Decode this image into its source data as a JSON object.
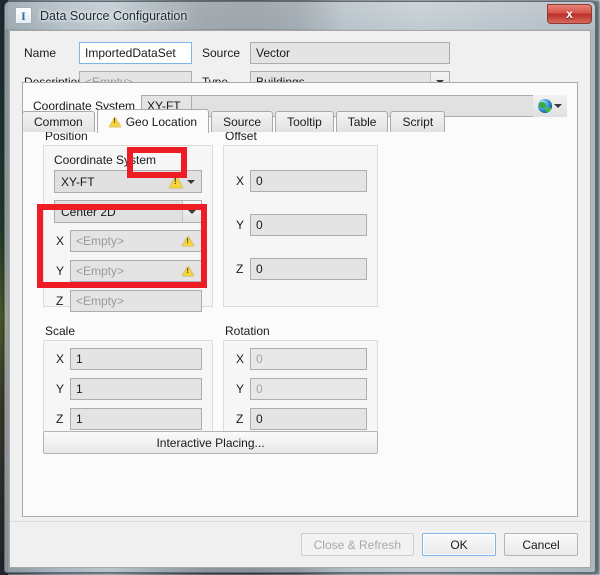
{
  "window": {
    "title": "Data Source Configuration",
    "app_icon": "application-icon",
    "close_label": "x"
  },
  "header": {
    "name_label": "Name",
    "name_value": "ImportedDataSet",
    "description_label": "Description",
    "description_placeholder": "<Empty>",
    "source_label": "Source",
    "source_value": "Vector",
    "type_label": "Type",
    "type_value": "Buildings"
  },
  "tabs": [
    {
      "label": "Common",
      "active": false,
      "warning": false
    },
    {
      "label": "Geo Location",
      "active": true,
      "warning": true
    },
    {
      "label": "Source",
      "active": false,
      "warning": false
    },
    {
      "label": "Tooltip",
      "active": false,
      "warning": false
    },
    {
      "label": "Table",
      "active": false,
      "warning": false
    },
    {
      "label": "Script",
      "active": false,
      "warning": false
    }
  ],
  "geo": {
    "coordinate_system_label": "Coordinate System",
    "coordinate_system_value": "XY-FT",
    "globe_icon": "globe-icon",
    "position": {
      "title": "Position",
      "cs_label": "Coordinate System",
      "cs_combo_value": "XY-FT",
      "cs_combo_warning": true,
      "mode_combo_value": "Center 2D",
      "fields": [
        {
          "axis": "X",
          "value": "<Empty>",
          "empty": true,
          "warning": true
        },
        {
          "axis": "Y",
          "value": "<Empty>",
          "empty": true,
          "warning": true
        },
        {
          "axis": "Z",
          "value": "<Empty>",
          "empty": true,
          "warning": false
        }
      ]
    },
    "offset": {
      "title": "Offset",
      "fields": [
        {
          "axis": "X",
          "value": "0",
          "disabled": false
        },
        {
          "axis": "Y",
          "value": "0",
          "disabled": false
        },
        {
          "axis": "Z",
          "value": "0",
          "disabled": false
        }
      ]
    },
    "scale": {
      "title": "Scale",
      "fields": [
        {
          "axis": "X",
          "value": "1",
          "disabled": false
        },
        {
          "axis": "Y",
          "value": "1",
          "disabled": false
        },
        {
          "axis": "Z",
          "value": "1",
          "disabled": false
        }
      ]
    },
    "rotation": {
      "title": "Rotation",
      "fields": [
        {
          "axis": "X",
          "value": "0",
          "disabled": true
        },
        {
          "axis": "Y",
          "value": "0",
          "disabled": true
        },
        {
          "axis": "Z",
          "value": "0",
          "disabled": false
        }
      ]
    },
    "interactive_placing_label": "Interactive Placing..."
  },
  "footer": {
    "close_refresh_label": "Close & Refresh",
    "close_refresh_disabled": true,
    "ok_label": "OK",
    "cancel_label": "Cancel"
  },
  "annotations": {
    "highlight_color": "#ee1c25",
    "boxes": [
      {
        "name": "coordinate-system-value-highlight"
      },
      {
        "name": "position-coordinate-system-highlight"
      }
    ]
  }
}
